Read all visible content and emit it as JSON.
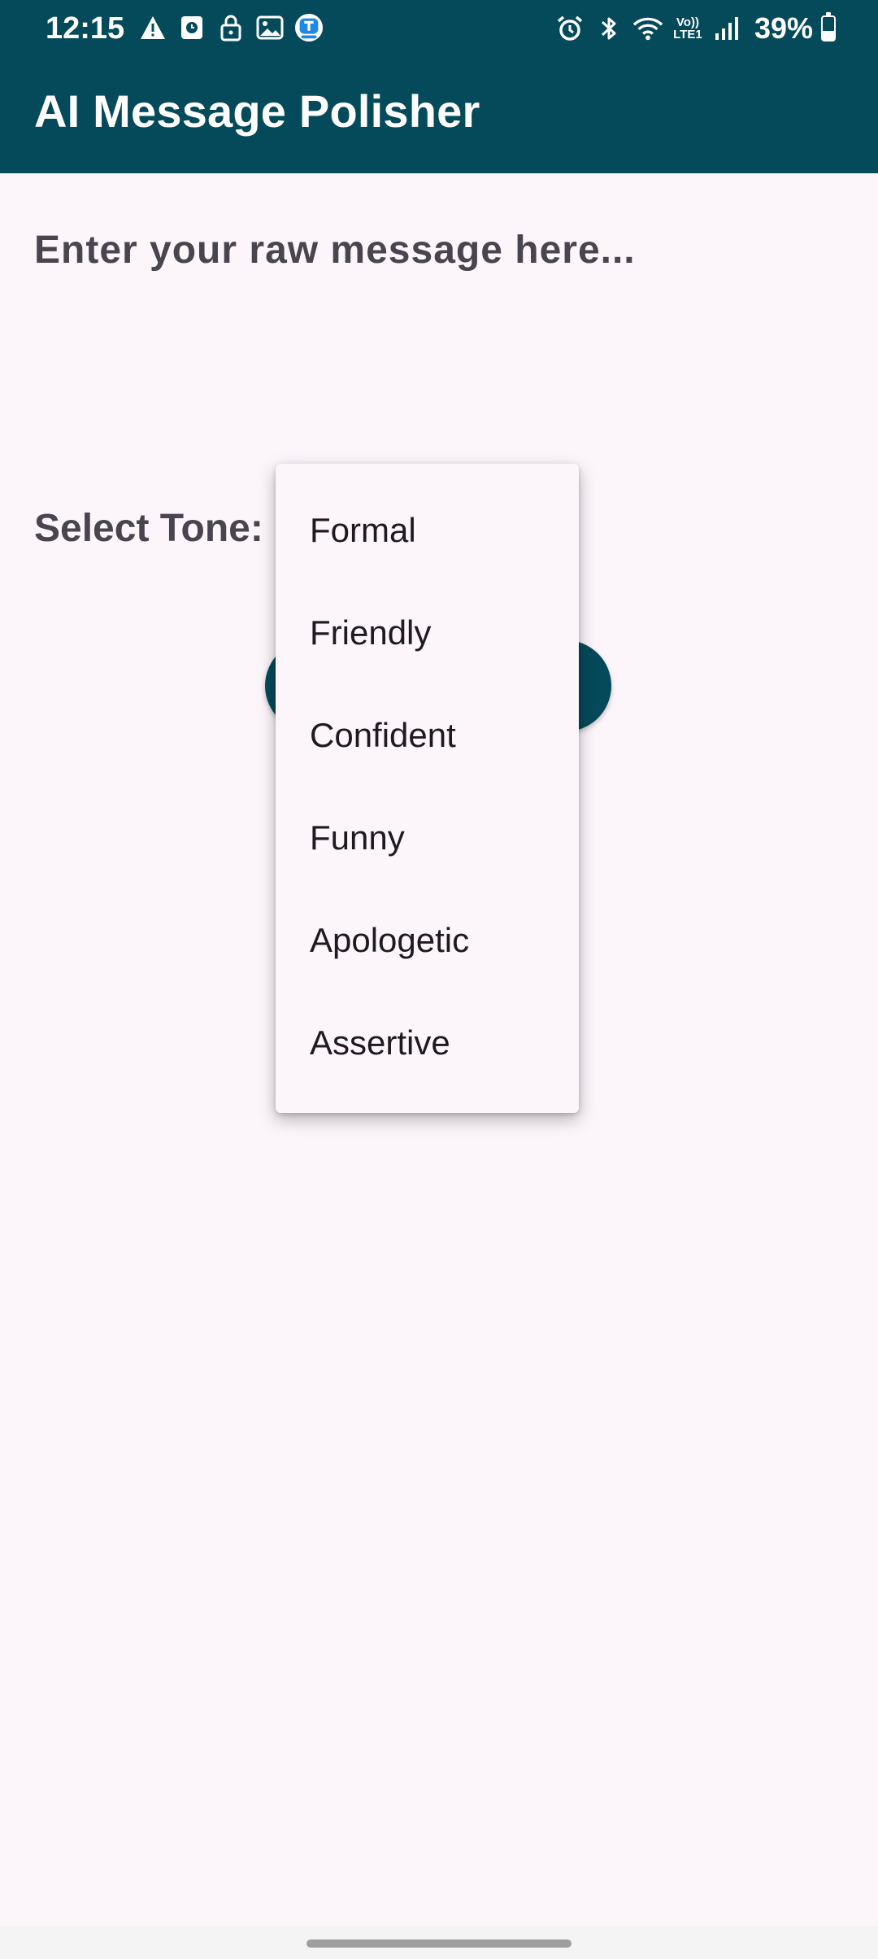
{
  "status_bar": {
    "time": "12:15",
    "left_icons": [
      "warning-icon",
      "clock-app-icon",
      "lock-icon",
      "gallery-icon",
      "app-notification-icon"
    ],
    "right_icons": [
      "alarm-icon",
      "bluetooth-icon",
      "wifi-icon",
      "volte-icon",
      "signal-icon"
    ],
    "volte_text_top": "Vo))",
    "volte_text_bottom": "LTE1",
    "battery_percent": "39%",
    "battery_level": 0.39
  },
  "app_bar": {
    "title": "AI Message Polisher"
  },
  "message_input": {
    "placeholder": "Enter your raw message here...",
    "value": ""
  },
  "tone": {
    "label": "Select Tone:"
  },
  "polish_button": {
    "label": ""
  },
  "tone_dropdown": {
    "options": [
      "Formal",
      "Friendly",
      "Confident",
      "Funny",
      "Apologetic",
      "Assertive"
    ]
  },
  "colors": {
    "primary": "#054a5a",
    "background": "#fcf6fb",
    "text_secondary": "#49454f",
    "menu_text": "#1d1b20"
  }
}
